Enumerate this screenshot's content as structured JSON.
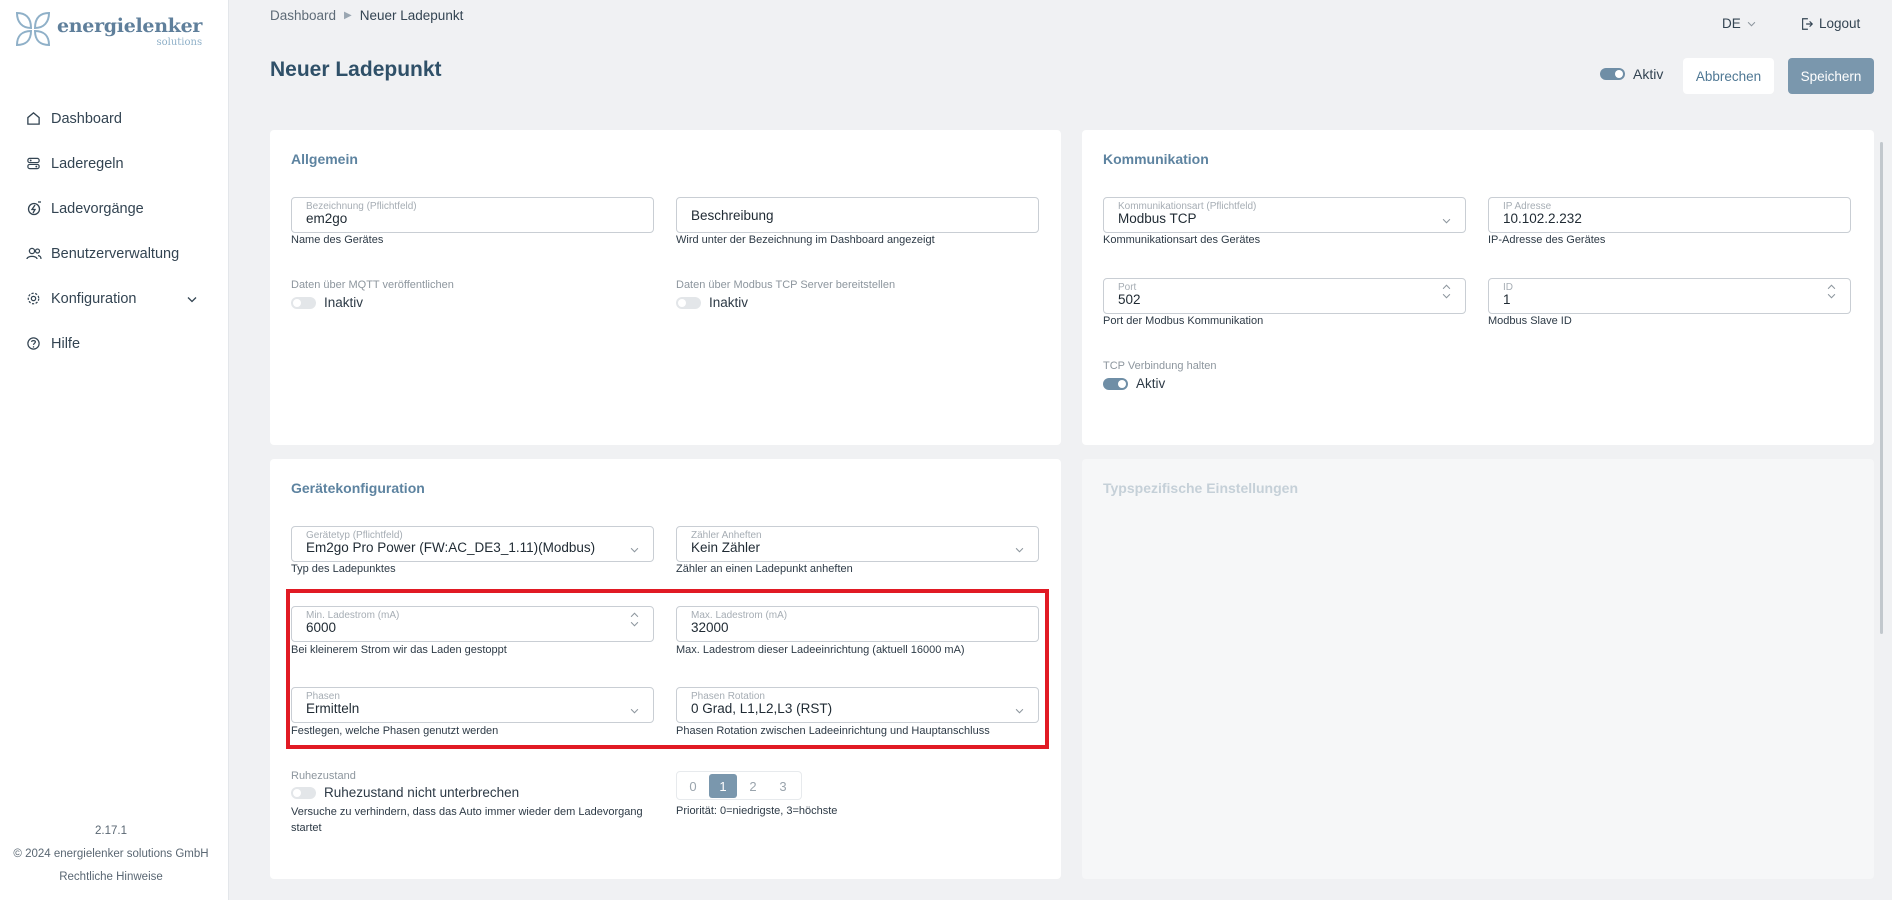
{
  "app": {
    "logo_main": "energielenker",
    "logo_sub": "solutions"
  },
  "sidebar": {
    "items": [
      {
        "label": "Dashboard",
        "icon": "home-icon"
      },
      {
        "label": "Laderegeln",
        "icon": "rules-icon"
      },
      {
        "label": "Ladevorgänge",
        "icon": "charging-icon"
      },
      {
        "label": "Benutzerverwaltung",
        "icon": "users-icon"
      },
      {
        "label": "Konfiguration",
        "icon": "gear-icon"
      },
      {
        "label": "Hilfe",
        "icon": "help-icon"
      }
    ],
    "version": "2.17.1",
    "copyright": "© 2024 energielenker solutions GmbH",
    "legal": "Rechtliche Hinweise"
  },
  "topbar": {
    "breadcrumb": [
      "Dashboard",
      "Neuer Ladepunkt"
    ],
    "language": "DE",
    "logout": "Logout"
  },
  "page": {
    "title": "Neuer Ladepunkt",
    "active_label": "Aktiv",
    "cancel_label": "Abbrechen",
    "save_label": "Speichern"
  },
  "allgemein": {
    "title": "Allgemein",
    "name_label": "Bezeichnung (Pflichtfeld)",
    "name_value": "em2go",
    "name_hint": "Name des Gerätes",
    "desc_placeholder": "Beschreibung",
    "desc_hint": "Wird unter der Bezeichnung im Dashboard angezeigt",
    "mqtt_label": "Daten über MQTT veröffentlichen",
    "mqtt_state": "Inaktiv",
    "modbus_label": "Daten über Modbus TCP Server bereitstellen",
    "modbus_state": "Inaktiv"
  },
  "kommunikation": {
    "title": "Kommunikation",
    "type_label": "Kommunikationsart (Pflichtfeld)",
    "type_value": "Modbus TCP",
    "type_hint": "Kommunikationsart des Gerätes",
    "ip_label": "IP Adresse",
    "ip_value": "10.102.2.232",
    "ip_hint": "IP-Adresse des Gerätes",
    "port_label": "Port",
    "port_value": "502",
    "port_hint": "Port der Modbus Kommunikation",
    "id_label": "ID",
    "id_value": "1",
    "id_hint": "Modbus Slave ID",
    "tcp_label": "TCP Verbindung halten",
    "tcp_state": "Aktiv"
  },
  "geraet": {
    "title": "Gerätekonfiguration",
    "type_label": "Gerätetyp (Pflichtfeld)",
    "type_value": "Em2go Pro Power (FW:AC_DE3_1.11)(Modbus)",
    "type_hint": "Typ des Ladepunktes",
    "meter_label": "Zähler Anheften",
    "meter_value": "Kein Zähler",
    "meter_hint": "Zähler an einen Ladepunkt anheften",
    "min_label": "Min. Ladestrom (mA)",
    "min_value": "6000",
    "min_hint": "Bei kleinerem Strom wir das Laden gestoppt",
    "max_label": "Max. Ladestrom (mA)",
    "max_value": "32000",
    "max_hint": "Max. Ladestrom dieser Ladeeinrichtung (aktuell 16000 mA)",
    "phases_label": "Phasen",
    "phases_value": "Ermitteln",
    "phases_hint": "Festlegen, welche Phasen genutzt werden",
    "rotation_label": "Phasen Rotation",
    "rotation_value": "0 Grad, L1,L2,L3 (RST)",
    "rotation_hint": "Phasen Rotation zwischen Ladeeinrichtung und Hauptanschluss",
    "rest_label": "Ruhezustand",
    "rest_state": "Ruhezustand nicht unterbrechen",
    "rest_hint_1": "Versuche zu verhindern, dass das Auto immer wieder dem Ladevorgang",
    "rest_hint_2": "startet",
    "priority_options": [
      "0",
      "1",
      "2",
      "3"
    ],
    "priority_selected": "1",
    "priority_hint": "Priorität: 0=niedrigste, 3=höchste"
  },
  "typspezifisch": {
    "title": "Typspezifische Einstellungen"
  },
  "colors": {
    "accent": "#7a97ad",
    "title": "#2f5068",
    "highlight": "#e11a24"
  }
}
